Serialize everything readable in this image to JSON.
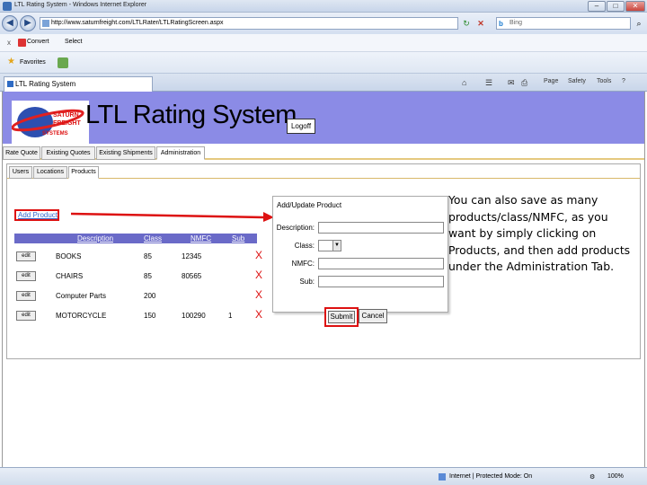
{
  "browser": {
    "window_title": "LTL Rating System - Windows Internet Explorer",
    "url": "http://www.saturnfreight.com/LTLRater/LTLRatingScreen.aspx",
    "search_placeholder": "Bing",
    "search_engine_glyph": "b",
    "convert_label": "Convert",
    "select_label": "Select",
    "close_toolbar_glyph": "x",
    "favorites_label": "Favorites",
    "tab_title": "LTL Rating System",
    "toolbar": {
      "page": "Page",
      "safety": "Safety",
      "tools": "Tools",
      "help": "?"
    },
    "status": {
      "zone": "Internet | Protected Mode: On",
      "zoom": "100%"
    }
  },
  "app": {
    "title": "LTL Rating System",
    "logo_text": [
      "SATURN",
      "FREIGHT",
      "SYSTEMS"
    ],
    "logoff_label": "Logoff",
    "main_tabs": [
      "Rate Quote",
      "Existing Quotes",
      "Existing Shipments",
      "Administration"
    ],
    "active_main_tab": "Administration",
    "sub_tabs": [
      "Users",
      "Locations",
      "Products"
    ],
    "active_sub_tab": "Products",
    "add_product_link": "Add Product",
    "table": {
      "headers": [
        "Description",
        "Class",
        "NMFC",
        "Sub"
      ],
      "edit_label": "edit",
      "delete_glyph": "X",
      "rows": [
        {
          "description": "BOOKS",
          "class": "85",
          "nmfc": "12345",
          "sub": ""
        },
        {
          "description": "CHAIRS",
          "class": "85",
          "nmfc": "80565",
          "sub": ""
        },
        {
          "description": "Computer Parts",
          "class": "200",
          "nmfc": "",
          "sub": ""
        },
        {
          "description": "MOTORCYCLE",
          "class": "150",
          "nmfc": "100290",
          "sub": "1"
        }
      ]
    },
    "form": {
      "title": "Add/Update Product",
      "description_label": "Description:",
      "class_label": "Class:",
      "nmfc_label": "NMFC:",
      "sub_label": "Sub:",
      "submit_label": "Submit",
      "cancel_label": "Cancel"
    }
  },
  "annotation": {
    "lines": [
      "You can also save  as many",
      " products/class/NMFC, as you",
      "want by simply clicking on",
      "Products, and then add products",
      " under the Administration Tab."
    ],
    "color": "#d11111"
  }
}
